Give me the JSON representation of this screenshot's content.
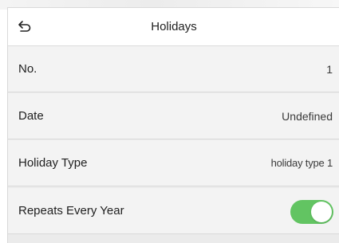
{
  "header": {
    "title": "Holidays",
    "back_icon": "undo-arrow-icon"
  },
  "rows": [
    {
      "label": "No.",
      "value": "1"
    },
    {
      "label": "Date",
      "value": "Undefined"
    },
    {
      "label": "Holiday Type",
      "value": "holiday type 1"
    },
    {
      "label": "Repeats Every Year",
      "toggle_on": true
    }
  ],
  "colors": {
    "toggle_on": "#62c462",
    "row_background": "#f3f3f3",
    "header_background": "#ffffff"
  }
}
